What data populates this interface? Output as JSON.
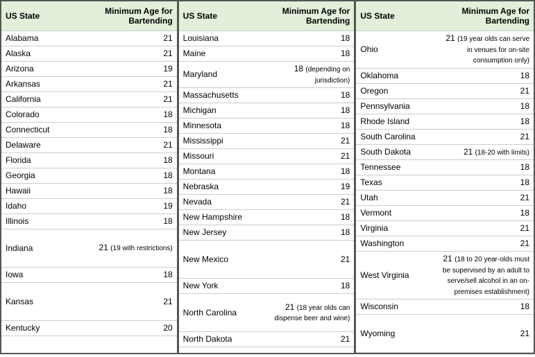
{
  "headers": {
    "state": "US State",
    "age": "Minimum Age for Bartending"
  },
  "columns": [
    [
      {
        "state": "Alabama",
        "age": "21"
      },
      {
        "state": "Alaska",
        "age": "21"
      },
      {
        "state": "Arizona",
        "age": "19"
      },
      {
        "state": "Arkansas",
        "age": "21"
      },
      {
        "state": "California",
        "age": "21"
      },
      {
        "state": "Colorado",
        "age": "18"
      },
      {
        "state": "Connecticut",
        "age": "18"
      },
      {
        "state": "Delaware",
        "age": "21"
      },
      {
        "state": "Florida",
        "age": "18"
      },
      {
        "state": "Georgia",
        "age": "18"
      },
      {
        "state": "Hawaii",
        "age": "18"
      },
      {
        "state": "Idaho",
        "age": "19"
      },
      {
        "state": "Illinois",
        "age": "18"
      },
      {
        "state": "Indiana",
        "age": "21",
        "note": "(19 with restrictions)",
        "tall": true
      },
      {
        "state": "Iowa",
        "age": "18"
      },
      {
        "state": "Kansas",
        "age": "21",
        "tall": true
      },
      {
        "state": "Kentucky",
        "age": "20"
      }
    ],
    [
      {
        "state": "Louisiana",
        "age": "18"
      },
      {
        "state": "Maine",
        "age": "18"
      },
      {
        "state": "Maryland",
        "age": "18",
        "note": "(depending on jurisdiction)"
      },
      {
        "state": "Massachusetts",
        "age": "18"
      },
      {
        "state": "Michigan",
        "age": "18"
      },
      {
        "state": "Minnesota",
        "age": "18"
      },
      {
        "state": "Mississippi",
        "age": "21"
      },
      {
        "state": "Missouri",
        "age": "21"
      },
      {
        "state": "Montana",
        "age": "18"
      },
      {
        "state": "Nebraska",
        "age": "19"
      },
      {
        "state": "Nevada",
        "age": "21"
      },
      {
        "state": "New Hampshire",
        "age": "18"
      },
      {
        "state": "New Jersey",
        "age": "18"
      },
      {
        "state": "New Mexico",
        "age": "21",
        "tall": true
      },
      {
        "state": "New York",
        "age": "18"
      },
      {
        "state": "North Carolina",
        "age": "21",
        "note": "(18 year olds can dispense beer and wine)",
        "tall": true
      },
      {
        "state": "North Dakota",
        "age": "21"
      }
    ],
    [
      {
        "state": "Ohio",
        "age": "21",
        "note": "(19 year olds can serve in venues for on-site consumption only)"
      },
      {
        "state": "Oklahoma",
        "age": "18"
      },
      {
        "state": "Oregon",
        "age": "21"
      },
      {
        "state": "Pennsylvania",
        "age": "18"
      },
      {
        "state": "Rhode Island",
        "age": "18"
      },
      {
        "state": "South Carolina",
        "age": "21"
      },
      {
        "state": "South Dakota",
        "age": "21",
        "note": "(18-20 with limits)"
      },
      {
        "state": "Tennessee",
        "age": "18"
      },
      {
        "state": "Texas",
        "age": "18"
      },
      {
        "state": "Utah",
        "age": "21"
      },
      {
        "state": "Vermont",
        "age": "18"
      },
      {
        "state": "Virginia",
        "age": "21"
      },
      {
        "state": "Washington",
        "age": "21"
      },
      {
        "state": "West Virginia",
        "age": "21",
        "note": "(18 to 20 year-olds must be supervised by an adult to serve/sell alcohol in an on-premises establishment)",
        "tall": true
      },
      {
        "state": "Wisconsin",
        "age": "18"
      },
      {
        "state": "Wyoming",
        "age": "21",
        "tall": true
      }
    ]
  ]
}
